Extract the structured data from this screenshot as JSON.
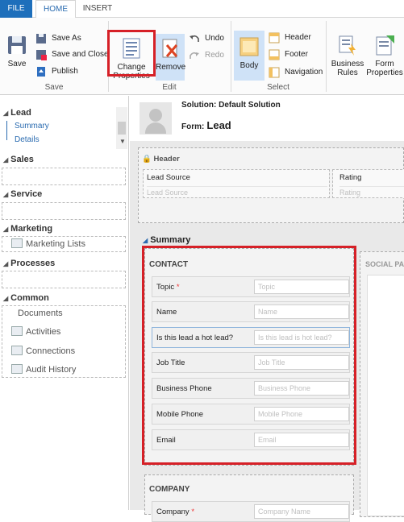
{
  "tabs": {
    "file": "FILE",
    "home": "HOME",
    "insert": "INSERT"
  },
  "ribbon": {
    "save": "Save",
    "save_as": "Save As",
    "save_and_close": "Save and Close",
    "publish": "Publish",
    "save_group": "Save",
    "change_properties_1": "Change",
    "change_properties_2": "Properties",
    "remove": "Remove",
    "undo": "Undo",
    "redo": "Redo",
    "edit_group": "Edit",
    "body": "Body",
    "header": "Header",
    "footer": "Footer",
    "navigation": "Navigation",
    "select_group": "Select",
    "business_rules_1": "Business",
    "business_rules_2": "Rules",
    "form_properties_1": "Form",
    "form_properties_2": "Properties"
  },
  "nav": {
    "lead": "Lead",
    "summary": "Summary",
    "details": "Details",
    "sales": "Sales",
    "service": "Service",
    "marketing": "Marketing",
    "marketing_lists": "Marketing Lists",
    "processes": "Processes",
    "common": "Common",
    "documents": "Documents",
    "activities": "Activities",
    "connections": "Connections",
    "audit_history": "Audit History"
  },
  "form": {
    "solution_label": "Solution:",
    "solution_value": "Default Solution",
    "form_label": "Form:",
    "form_value": "Lead"
  },
  "header_section": {
    "title": "Header",
    "lead_source_label": "Lead Source",
    "lead_source_placeholder": "Lead Source",
    "rating_label": "Rating",
    "rating_placeholder": "Rating"
  },
  "summary_tab": {
    "title": "Summary",
    "social_pane": "SOCIAL PA"
  },
  "contact": {
    "title": "CONTACT",
    "fields": [
      {
        "label": "Topic",
        "placeholder": "Topic",
        "required": "*"
      },
      {
        "label": "Name",
        "placeholder": "Name"
      },
      {
        "label": "Is this lead a hot lead?",
        "placeholder": "Is this lead is hot lead?"
      },
      {
        "label": "Job Title",
        "placeholder": "Job Title"
      },
      {
        "label": "Business Phone",
        "placeholder": "Business Phone"
      },
      {
        "label": "Mobile Phone",
        "placeholder": "Mobile Phone"
      },
      {
        "label": "Email",
        "placeholder": "Email"
      }
    ]
  },
  "company": {
    "title": "COMPANY",
    "fields": [
      {
        "label": "Company",
        "placeholder": "Company Name",
        "required": "*"
      }
    ]
  },
  "colors": {
    "accent": "#1e6fbb",
    "highlight": "#d62027",
    "selected": "#cfe2f7"
  }
}
